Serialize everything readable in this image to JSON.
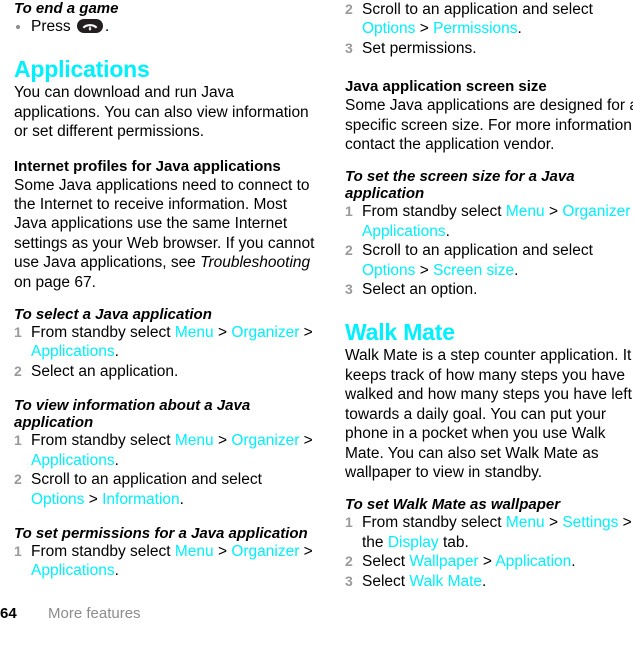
{
  "document": {
    "footer": {
      "page_number": "64",
      "section": "More features"
    }
  },
  "left_column": {
    "end_game": {
      "heading": "To end a game",
      "bullet_prefix": "Press",
      "key_icon": "end-call-key-icon",
      "bullet_suffix": "."
    },
    "applications": {
      "heading": "Applications",
      "intro": "You can download and run Java applications. You can also view information or set different permissions."
    },
    "internet_profiles": {
      "heading": "Internet profiles for Java applications",
      "para_part1": "Some Java applications need to connect to the Internet to receive information. Most Java applications use the same Internet settings as your Web browser. If you cannot use Java applications, see ",
      "para_italic": "Troubleshooting",
      "para_part2": " on page 67."
    },
    "select_java_app": {
      "heading": "To select a Java application",
      "steps": [
        {
          "pre": "From standby select ",
          "link1": "Menu",
          "sep1": " > ",
          "link2": "Organizer",
          "sep2": " > ",
          "link3": "Applications",
          "post": "."
        },
        {
          "pre": "Select an application.",
          "link1": "",
          "sep1": "",
          "link2": "",
          "sep2": "",
          "link3": "",
          "post": ""
        }
      ]
    },
    "view_info_java_app": {
      "heading": "To view information about a Java application",
      "steps": [
        {
          "pre": "From standby select ",
          "link1": "Menu",
          "sep1": " > ",
          "link2": "Organizer",
          "sep2": " > ",
          "link3": "Applications",
          "post": "."
        },
        {
          "pre": "Scroll to an application and select ",
          "link1": "Options",
          "sep1": " > ",
          "link2": "Information",
          "sep2": "",
          "link3": "",
          "post": "."
        }
      ]
    },
    "set_permissions_java_app": {
      "heading": "To set permissions for a Java application",
      "steps": [
        {
          "pre": "From standby select ",
          "link1": "Menu",
          "sep1": " > ",
          "link2": "Organizer",
          "sep2": " > ",
          "link3": "Applications",
          "post": "."
        }
      ]
    }
  },
  "right_column": {
    "set_permissions_continued": {
      "steps": [
        {
          "number": "2",
          "pre": "Scroll to an application and select ",
          "link1": "Options",
          "sep1": " > ",
          "link2": "Permissions",
          "sep2": "",
          "link3": "",
          "post": "."
        },
        {
          "number": "3",
          "pre": "Set permissions.",
          "link1": "",
          "sep1": "",
          "link2": "",
          "sep2": "",
          "link3": "",
          "post": ""
        }
      ]
    },
    "screen_size": {
      "heading": "Java application screen size",
      "para": "Some Java applications are designed for a specific screen size. For more information, contact the application vendor."
    },
    "set_screen_size": {
      "heading": "To set the screen size for a Java application",
      "steps": [
        {
          "pre": "From standby select ",
          "link1": "Menu",
          "sep1": " > ",
          "link2": "Organizer",
          "sep2": " > ",
          "link3": "Applications",
          "post": "."
        },
        {
          "pre": "Scroll to an application and select ",
          "link1": "Options",
          "sep1": " > ",
          "link2": "Screen size",
          "sep2": "",
          "link3": "",
          "post": "."
        },
        {
          "pre": "Select an option.",
          "link1": "",
          "sep1": "",
          "link2": "",
          "sep2": "",
          "link3": "",
          "post": ""
        }
      ]
    },
    "walk_mate": {
      "heading": "Walk Mate",
      "intro": "Walk Mate is a step counter application. It keeps track of how many steps you have walked and how many steps you have left towards a daily goal. You can put your phone in a pocket when you use Walk Mate. You can also set Walk Mate as wallpaper to view in standby."
    },
    "walk_mate_wallpaper": {
      "heading": "To set Walk Mate as wallpaper",
      "steps": [
        {
          "pre": "From standby select ",
          "link1": "Menu",
          "sep1": " > ",
          "link2": "Settings",
          "sep2": " > the ",
          "link3": "Display",
          "post": " tab."
        },
        {
          "pre": "Select ",
          "link1": "Wallpaper",
          "sep1": " > ",
          "link2": "Application",
          "sep2": "",
          "link3": "",
          "post": "."
        },
        {
          "pre": "Select ",
          "link1": "Walk Mate",
          "sep1": "",
          "link2": "",
          "sep2": "",
          "link3": "",
          "post": "."
        }
      ]
    }
  },
  "colors": {
    "link": "#00f0ff",
    "heading": "#00f0ff",
    "body": "#000000",
    "muted": "#8c8c8c"
  }
}
